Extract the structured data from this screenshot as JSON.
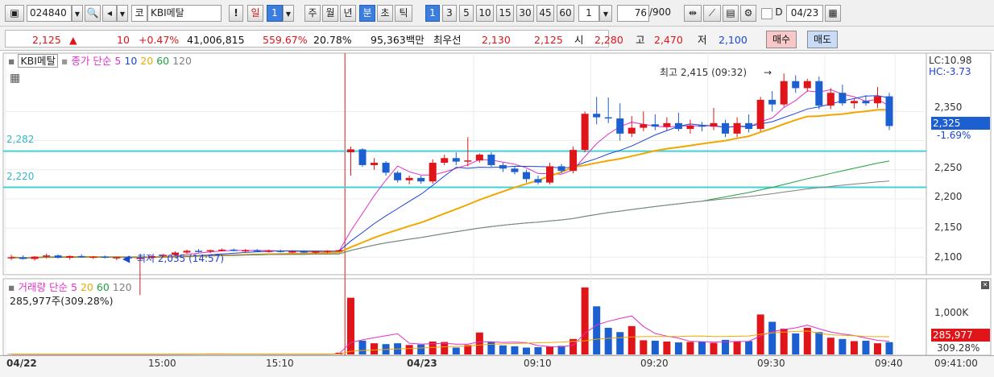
{
  "toolbar": {
    "code": "024840",
    "market": "코",
    "name": "KBI메탈",
    "alert": "!",
    "periods": [
      "일",
      "1",
      "주",
      "월",
      "년",
      "분",
      "초",
      "틱"
    ],
    "minute_options": [
      "1",
      "3",
      "5",
      "10",
      "15",
      "30",
      "45",
      "60"
    ],
    "interval": "1",
    "count": "76",
    "count_total": "/900",
    "date_checkbox": "D",
    "date": "04/23"
  },
  "quote": {
    "price": "2,125",
    "change_arrow": "▲",
    "change": "10",
    "change_pct": "+0.47%",
    "volume": "41,006,815",
    "volume_ratio": "559.67%",
    "turnover_rate": "20.78%",
    "amount": "95,363백만",
    "best_label": "최우선",
    "best_ask": "2,130",
    "best_bid": "2,125",
    "open_label": "시",
    "open": "2,280",
    "high_label": "고",
    "high": "2,470",
    "low_label": "저",
    "low": "2,100",
    "buy_label": "매수",
    "sell_label": "매도"
  },
  "price_panel": {
    "legend_name": "KBI메탈",
    "legend_ma": "종가 단순",
    "ma_periods": [
      "5",
      "10",
      "20",
      "60",
      "120"
    ],
    "lc": "LC:10.98",
    "hc": "HC:-3.73",
    "hline1": "2,282",
    "hline2": "2,220",
    "max_annotation": "최고 2,415 (09:32)",
    "min_annotation": "최저 2,035 (14:57)",
    "current_price": "2,325",
    "current_pct": "-1.69%",
    "y_ticks": [
      "2,350",
      "2,300",
      "2,250",
      "2,200",
      "2,150",
      "2,100"
    ]
  },
  "volume_panel": {
    "legend_name": "거래량",
    "legend_ma": "단순",
    "ma_periods": [
      "5",
      "20",
      "60",
      "120"
    ],
    "current": "285,977주(309.28%)",
    "tick": "1,000K",
    "tag_value": "285,977",
    "tag_pct": "309.28%"
  },
  "time_axis": [
    "04/22",
    "15:00",
    "15:10",
    "04/23",
    "09:10",
    "09:20",
    "09:30",
    "09:40",
    "09:41:00"
  ],
  "colors": {
    "up": "#e0151a",
    "down": "#1c5fd0",
    "ma5": "#e030c8",
    "ma10": "#1c44d8",
    "ma20": "#f0a800",
    "ma60": "#20a040",
    "ma120": "#808080",
    "hline": "#40d0d8",
    "day_divider": "#e02020"
  },
  "chart_data": {
    "type": "candlestick",
    "unit": "1-minute",
    "ylim": [
      2070,
      2450
    ],
    "candles": [
      {
        "o": 2098,
        "h": 2104,
        "l": 2095,
        "c": 2100
      },
      {
        "o": 2100,
        "h": 2103,
        "l": 2096,
        "c": 2097
      },
      {
        "o": 2097,
        "h": 2102,
        "l": 2094,
        "c": 2101
      },
      {
        "o": 2101,
        "h": 2106,
        "l": 2098,
        "c": 2103
      },
      {
        "o": 2103,
        "h": 2105,
        "l": 2098,
        "c": 2099
      },
      {
        "o": 2099,
        "h": 2103,
        "l": 2096,
        "c": 2102
      },
      {
        "o": 2102,
        "h": 2105,
        "l": 2099,
        "c": 2100
      },
      {
        "o": 2100,
        "h": 2102,
        "l": 2097,
        "c": 2101
      },
      {
        "o": 2101,
        "h": 2103,
        "l": 2098,
        "c": 2099
      },
      {
        "o": 2099,
        "h": 2101,
        "l": 2095,
        "c": 2100
      },
      {
        "o": 2100,
        "h": 2102,
        "l": 2097,
        "c": 2098
      },
      {
        "o": 2098,
        "h": 2100,
        "l": 2035,
        "c": 2099
      },
      {
        "o": 2099,
        "h": 2103,
        "l": 2097,
        "c": 2102
      },
      {
        "o": 2102,
        "h": 2106,
        "l": 2100,
        "c": 2104
      },
      {
        "o": 2104,
        "h": 2110,
        "l": 2102,
        "c": 2108
      },
      {
        "o": 2108,
        "h": 2113,
        "l": 2106,
        "c": 2111
      },
      {
        "o": 2111,
        "h": 2114,
        "l": 2108,
        "c": 2110
      },
      {
        "o": 2110,
        "h": 2113,
        "l": 2107,
        "c": 2112
      },
      {
        "o": 2112,
        "h": 2115,
        "l": 2110,
        "c": 2113
      },
      {
        "o": 2113,
        "h": 2115,
        "l": 2110,
        "c": 2111
      },
      {
        "o": 2111,
        "h": 2114,
        "l": 2108,
        "c": 2112
      },
      {
        "o": 2112,
        "h": 2114,
        "l": 2109,
        "c": 2110
      },
      {
        "o": 2110,
        "h": 2113,
        "l": 2108,
        "c": 2111
      },
      {
        "o": 2111,
        "h": 2113,
        "l": 2108,
        "c": 2109
      },
      {
        "o": 2109,
        "h": 2112,
        "l": 2107,
        "c": 2110
      },
      {
        "o": 2110,
        "h": 2112,
        "l": 2107,
        "c": 2108
      },
      {
        "o": 2108,
        "h": 2111,
        "l": 2106,
        "c": 2110
      },
      {
        "o": 2110,
        "h": 2112,
        "l": 2107,
        "c": 2111
      },
      {
        "o": 2111,
        "h": 2113,
        "l": 2109,
        "c": 2112
      },
      {
        "o": 2280,
        "h": 2290,
        "l": 2240,
        "c": 2285
      },
      {
        "o": 2285,
        "h": 2287,
        "l": 2255,
        "c": 2258
      },
      {
        "o": 2258,
        "h": 2270,
        "l": 2250,
        "c": 2262
      },
      {
        "o": 2262,
        "h": 2265,
        "l": 2240,
        "c": 2245
      },
      {
        "o": 2245,
        "h": 2248,
        "l": 2228,
        "c": 2232
      },
      {
        "o": 2232,
        "h": 2240,
        "l": 2225,
        "c": 2236
      },
      {
        "o": 2236,
        "h": 2240,
        "l": 2226,
        "c": 2230
      },
      {
        "o": 2230,
        "h": 2268,
        "l": 2226,
        "c": 2262
      },
      {
        "o": 2262,
        "h": 2276,
        "l": 2258,
        "c": 2270
      },
      {
        "o": 2270,
        "h": 2280,
        "l": 2258,
        "c": 2264
      },
      {
        "o": 2264,
        "h": 2306,
        "l": 2256,
        "c": 2266
      },
      {
        "o": 2266,
        "h": 2278,
        "l": 2262,
        "c": 2276
      },
      {
        "o": 2276,
        "h": 2280,
        "l": 2255,
        "c": 2258
      },
      {
        "o": 2258,
        "h": 2262,
        "l": 2246,
        "c": 2252
      },
      {
        "o": 2252,
        "h": 2256,
        "l": 2242,
        "c": 2246
      },
      {
        "o": 2246,
        "h": 2250,
        "l": 2228,
        "c": 2234
      },
      {
        "o": 2234,
        "h": 2240,
        "l": 2225,
        "c": 2228
      },
      {
        "o": 2228,
        "h": 2262,
        "l": 2225,
        "c": 2256
      },
      {
        "o": 2256,
        "h": 2260,
        "l": 2244,
        "c": 2248
      },
      {
        "o": 2248,
        "h": 2290,
        "l": 2244,
        "c": 2284
      },
      {
        "o": 2284,
        "h": 2350,
        "l": 2280,
        "c": 2346
      },
      {
        "o": 2346,
        "h": 2375,
        "l": 2328,
        "c": 2340
      },
      {
        "o": 2340,
        "h": 2374,
        "l": 2330,
        "c": 2338
      },
      {
        "o": 2338,
        "h": 2364,
        "l": 2300,
        "c": 2312
      },
      {
        "o": 2312,
        "h": 2342,
        "l": 2306,
        "c": 2322
      },
      {
        "o": 2322,
        "h": 2350,
        "l": 2316,
        "c": 2328
      },
      {
        "o": 2328,
        "h": 2345,
        "l": 2318,
        "c": 2324
      },
      {
        "o": 2324,
        "h": 2340,
        "l": 2318,
        "c": 2330
      },
      {
        "o": 2330,
        "h": 2348,
        "l": 2316,
        "c": 2320
      },
      {
        "o": 2320,
        "h": 2336,
        "l": 2312,
        "c": 2326
      },
      {
        "o": 2326,
        "h": 2332,
        "l": 2316,
        "c": 2324
      },
      {
        "o": 2324,
        "h": 2356,
        "l": 2318,
        "c": 2330
      },
      {
        "o": 2330,
        "h": 2336,
        "l": 2306,
        "c": 2312
      },
      {
        "o": 2312,
        "h": 2340,
        "l": 2306,
        "c": 2330
      },
      {
        "o": 2330,
        "h": 2345,
        "l": 2314,
        "c": 2320
      },
      {
        "o": 2320,
        "h": 2375,
        "l": 2316,
        "c": 2370
      },
      {
        "o": 2370,
        "h": 2385,
        "l": 2350,
        "c": 2362
      },
      {
        "o": 2362,
        "h": 2415,
        "l": 2358,
        "c": 2402
      },
      {
        "o": 2402,
        "h": 2412,
        "l": 2382,
        "c": 2390
      },
      {
        "o": 2390,
        "h": 2406,
        "l": 2384,
        "c": 2402
      },
      {
        "o": 2402,
        "h": 2410,
        "l": 2354,
        "c": 2360
      },
      {
        "o": 2360,
        "h": 2390,
        "l": 2354,
        "c": 2382
      },
      {
        "o": 2382,
        "h": 2396,
        "l": 2360,
        "c": 2364
      },
      {
        "o": 2364,
        "h": 2372,
        "l": 2355,
        "c": 2368
      },
      {
        "o": 2368,
        "h": 2378,
        "l": 2360,
        "c": 2364
      },
      {
        "o": 2364,
        "h": 2392,
        "l": 2356,
        "c": 2376
      },
      {
        "o": 2376,
        "h": 2382,
        "l": 2318,
        "c": 2325
      }
    ],
    "volume_k": [
      8,
      5,
      6,
      4,
      5,
      6,
      7,
      6,
      5,
      6,
      5,
      7,
      6,
      8,
      9,
      12,
      10,
      14,
      8,
      7,
      9,
      6,
      8,
      7,
      9,
      6,
      8,
      12,
      40,
      1320,
      320,
      260,
      240,
      260,
      220,
      230,
      300,
      290,
      160,
      220,
      510,
      300,
      210,
      190,
      160,
      170,
      180,
      200,
      360,
      1560,
      1120,
      620,
      520,
      660,
      330,
      320,
      300,
      280,
      290,
      300,
      270,
      340,
      310,
      310,
      930,
      760,
      600,
      490,
      620,
      520,
      390,
      360,
      310,
      320,
      260,
      286
    ]
  }
}
